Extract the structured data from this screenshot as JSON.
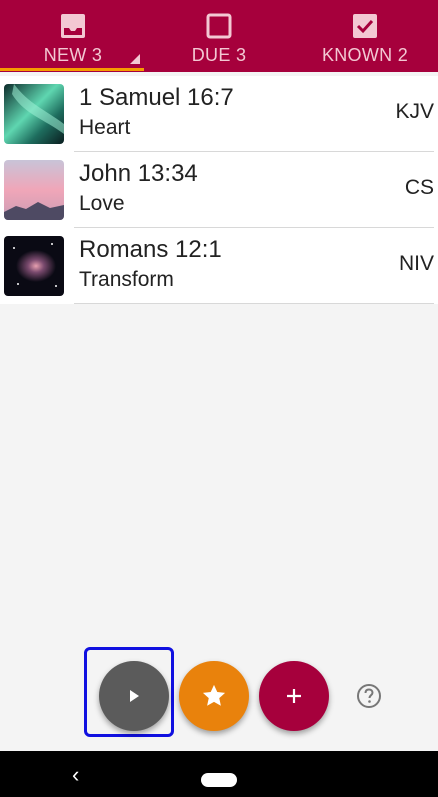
{
  "tabs": [
    {
      "label": "NEW 3",
      "icon": "inbox-icon"
    },
    {
      "label": "DUE 3",
      "icon": "checkbox-empty-icon"
    },
    {
      "label": "KNOWN 2",
      "icon": "checkbox-checked-icon"
    }
  ],
  "verses": [
    {
      "reference": "1 Samuel 16:7",
      "topic": "Heart",
      "version": "KJV",
      "image": "aurora-thumbnail"
    },
    {
      "reference": "John 13:34",
      "topic": "Love",
      "version": "CS",
      "image": "pink-sky-mountains-thumbnail"
    },
    {
      "reference": "Romans 12:1",
      "topic": "Transform",
      "version": "NIV",
      "image": "nebula-thumbnail"
    }
  ],
  "actions": {
    "play": "play-icon",
    "star": "star-icon",
    "add": "plus-icon",
    "help": "help-icon"
  },
  "colors": {
    "primary": "#a6003c",
    "accent": "#f59c00",
    "star_button": "#e9820c",
    "play_button": "#5b5b5b"
  }
}
